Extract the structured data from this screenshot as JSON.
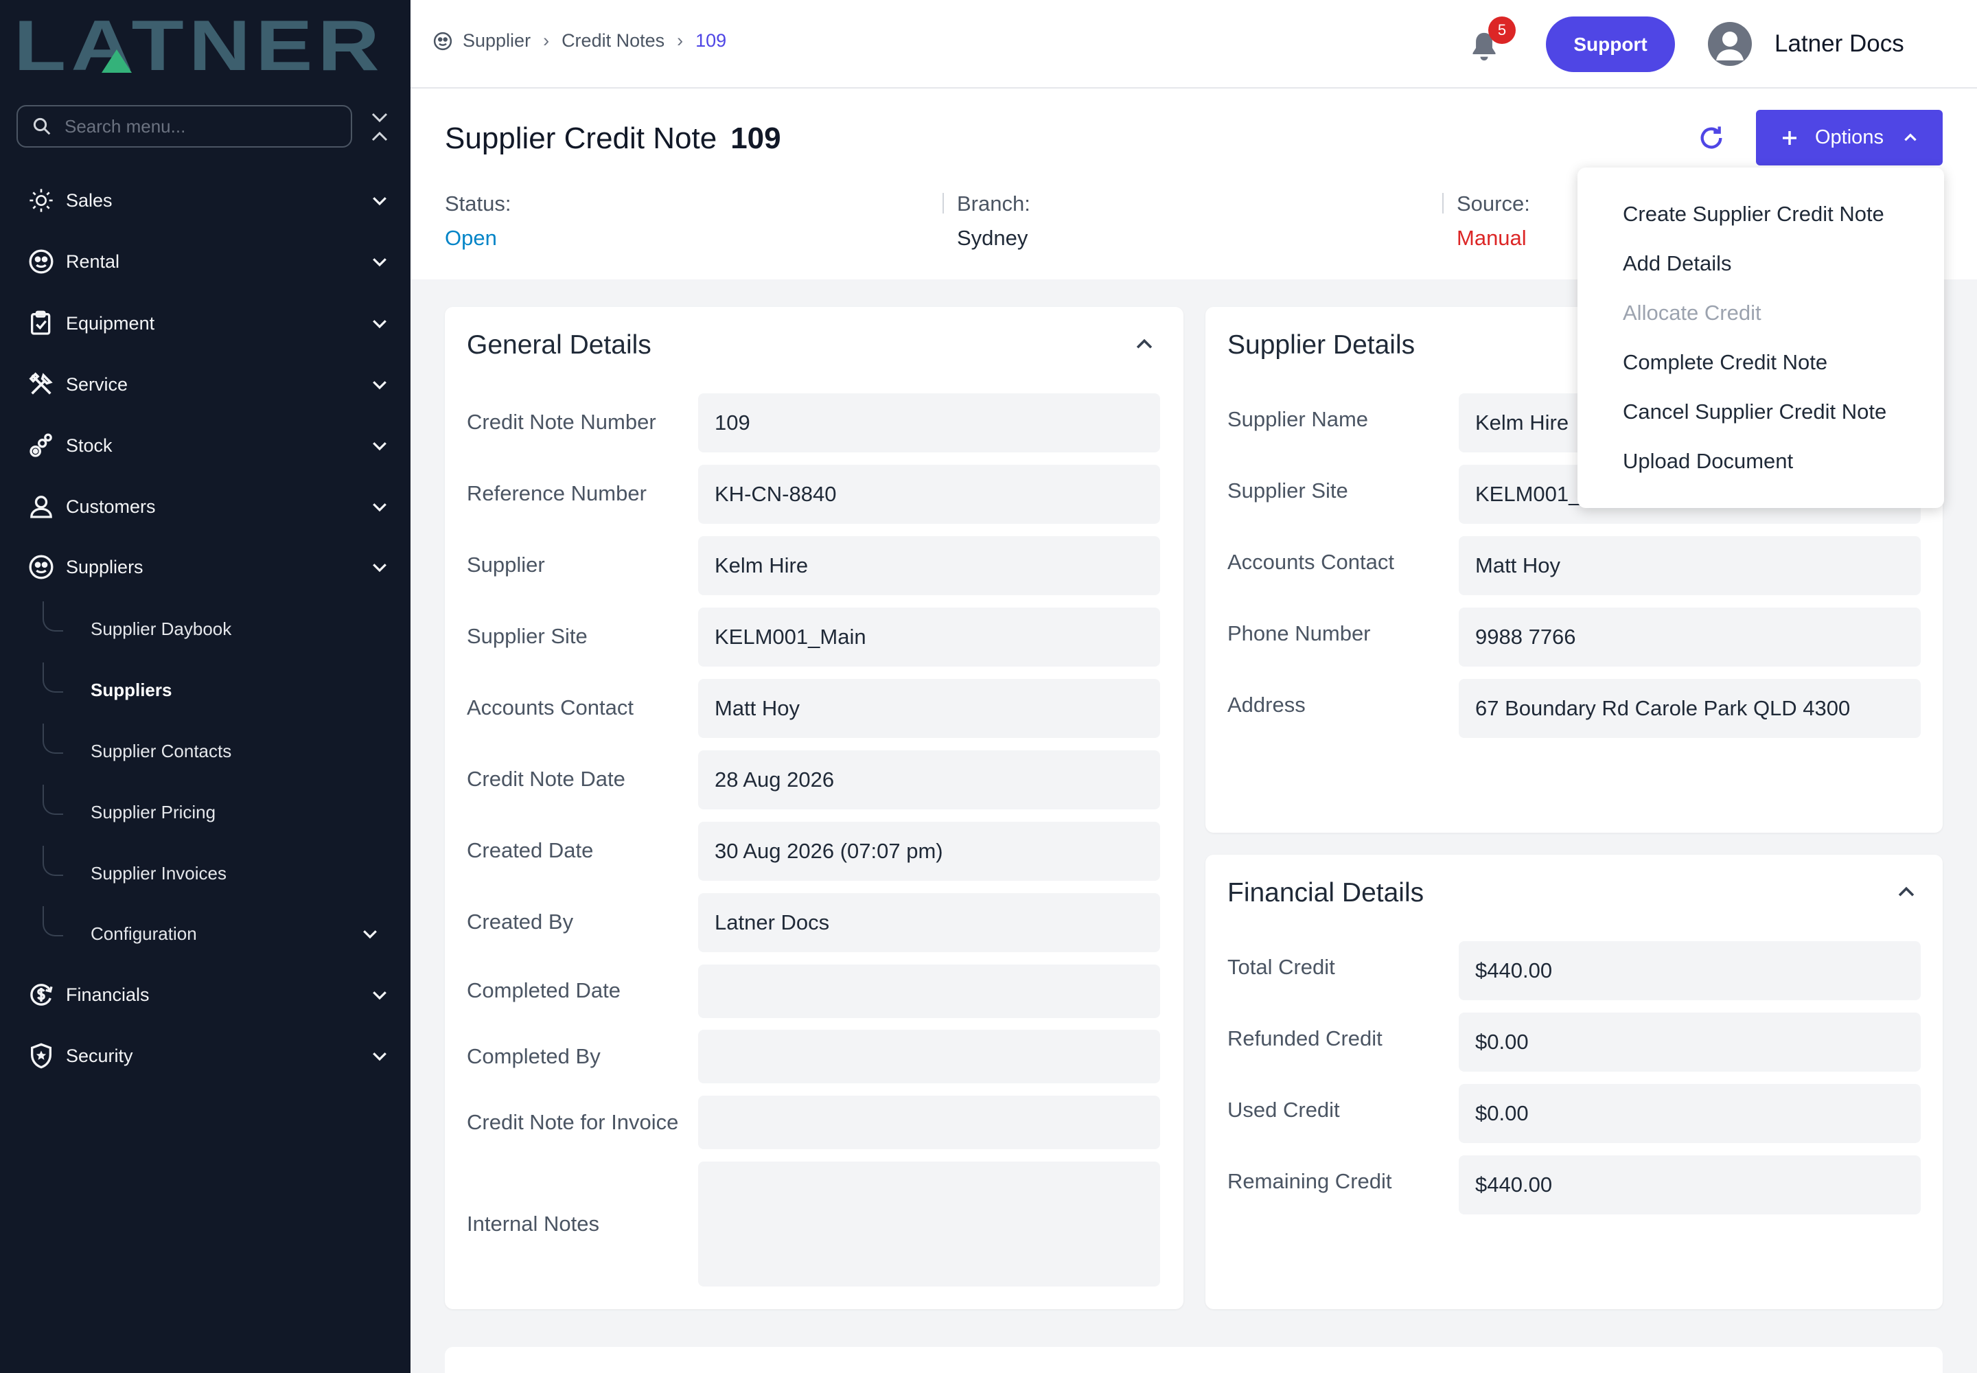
{
  "brand": {
    "logo_text": "LATNER"
  },
  "sidebar": {
    "search_placeholder": "Search menu...",
    "items": [
      {
        "label": "Sales",
        "icon": "sales-icon"
      },
      {
        "label": "Rental",
        "icon": "rental-icon"
      },
      {
        "label": "Equipment",
        "icon": "equipment-icon"
      },
      {
        "label": "Service",
        "icon": "service-icon"
      },
      {
        "label": "Stock",
        "icon": "stock-icon"
      },
      {
        "label": "Customers",
        "icon": "user-icon"
      },
      {
        "label": "Suppliers",
        "icon": "suppliers-icon"
      },
      {
        "label": "Financials",
        "icon": "financials-icon"
      },
      {
        "label": "Security",
        "icon": "shield-icon"
      }
    ],
    "sub_items": [
      {
        "label": "Supplier Daybook"
      },
      {
        "label": "Suppliers",
        "active": true
      },
      {
        "label": "Supplier Contacts"
      },
      {
        "label": "Supplier Pricing"
      },
      {
        "label": "Supplier Invoices"
      },
      {
        "label": "Configuration"
      }
    ]
  },
  "header": {
    "breadcrumb": [
      "Supplier",
      "Credit Notes",
      "109"
    ],
    "notification_count": "5",
    "support_label": "Support",
    "user_name": "Latner Docs"
  },
  "page": {
    "title": "Supplier Credit Note",
    "number": "109",
    "status_label": "Status:",
    "status_value": "Open",
    "branch_label": "Branch:",
    "branch_value": "Sydney",
    "source_label": "Source:",
    "source_value": "Manual",
    "options_label": "Options",
    "colors": {
      "accent": "#4f46e5",
      "status_open": "#0284c7",
      "source_manual": "#dc2626"
    }
  },
  "options_menu": [
    {
      "label": "Create Supplier Credit Note"
    },
    {
      "label": "Add Details"
    },
    {
      "label": "Allocate Credit",
      "disabled": true
    },
    {
      "label": "Complete Credit Note"
    },
    {
      "label": "Cancel Supplier Credit Note"
    },
    {
      "label": "Upload Document"
    }
  ],
  "general_details": {
    "title": "General Details",
    "rows": [
      {
        "label": "Credit Note Number",
        "value": "109"
      },
      {
        "label": "Reference Number",
        "value": "KH-CN-8840"
      },
      {
        "label": "Supplier",
        "value": "Kelm Hire"
      },
      {
        "label": "Supplier Site",
        "value": "KELM001_Main"
      },
      {
        "label": "Accounts Contact",
        "value": "Matt Hoy"
      },
      {
        "label": "Credit Note Date",
        "value": "28 Aug 2026"
      },
      {
        "label": "Created Date",
        "value": "30 Aug 2026 (07:07 pm)"
      },
      {
        "label": "Created By",
        "value": "Latner Docs"
      },
      {
        "label": "Completed Date",
        "value": ""
      },
      {
        "label": "Completed By",
        "value": ""
      },
      {
        "label": "Credit Note for Invoice",
        "value": ""
      },
      {
        "label": "Internal Notes",
        "value": ""
      }
    ]
  },
  "supplier_details": {
    "title": "Supplier Details",
    "rows": [
      {
        "label": "Supplier Name",
        "value": "Kelm Hire"
      },
      {
        "label": "Supplier Site",
        "value": "KELM001_Main"
      },
      {
        "label": "Accounts Contact",
        "value": "Matt Hoy"
      },
      {
        "label": "Phone Number",
        "value": "9988 7766"
      },
      {
        "label": "Address",
        "value": "67 Boundary Rd Carole Park QLD 4300"
      }
    ]
  },
  "financial_details": {
    "title": "Financial Details",
    "rows": [
      {
        "label": "Total Credit",
        "value": "$440.00"
      },
      {
        "label": "Refunded Credit",
        "value": "$0.00"
      },
      {
        "label": "Used Credit",
        "value": "$0.00"
      },
      {
        "label": "Remaining Credit",
        "value": "$440.00"
      }
    ]
  }
}
